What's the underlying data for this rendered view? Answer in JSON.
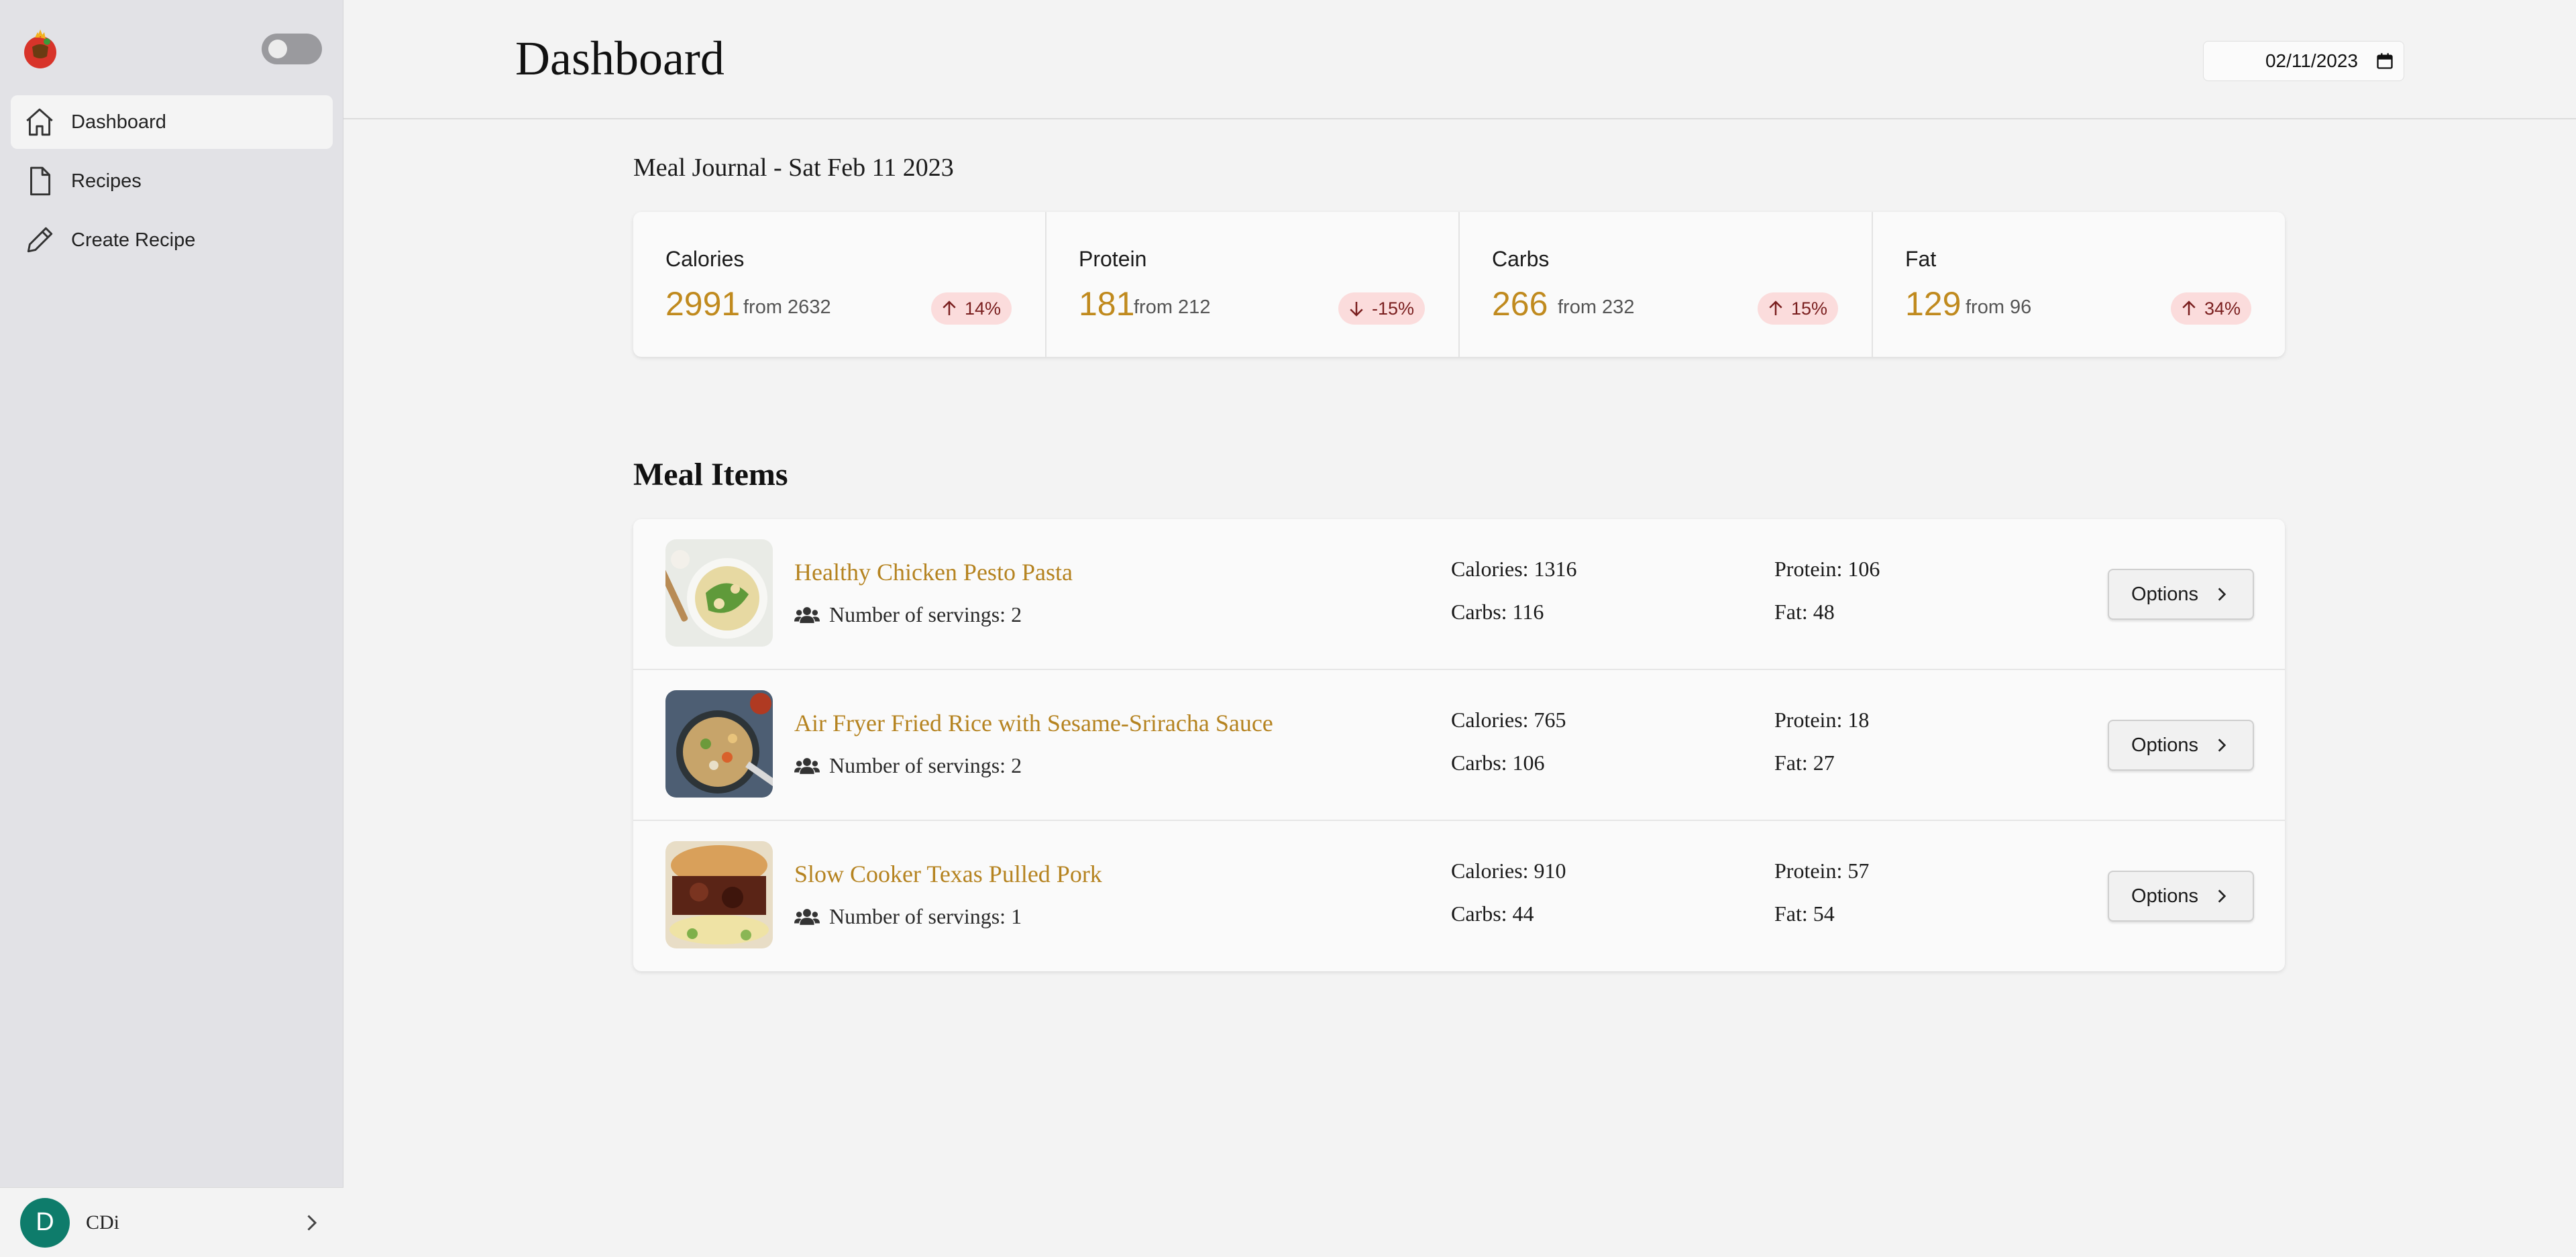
{
  "app": {
    "theme_toggle": "off"
  },
  "sidebar": {
    "items": [
      {
        "label": "Dashboard",
        "icon": "home-icon",
        "active": true
      },
      {
        "label": "Recipes",
        "icon": "document-icon",
        "active": false
      },
      {
        "label": "Create Recipe",
        "icon": "pencil-icon",
        "active": false
      }
    ]
  },
  "user": {
    "initial": "D",
    "name": "CDi",
    "avatar_color": "#0e7c6b"
  },
  "header": {
    "title": "Dashboard",
    "date": "02/11/2023"
  },
  "journal": {
    "title": "Meal Journal - Sat Feb 11 2023",
    "stats": [
      {
        "label": "Calories",
        "value": "2991",
        "from": "from 2632",
        "change": "14%",
        "direction": "up"
      },
      {
        "label": "Protein",
        "value": "181",
        "from": "from 212",
        "change": "-15%",
        "direction": "down"
      },
      {
        "label": "Carbs",
        "value": "266",
        "from": "from 232",
        "change": "15%",
        "direction": "up"
      },
      {
        "label": "Fat",
        "value": "129",
        "from": "from 96",
        "change": "34%",
        "direction": "up"
      }
    ]
  },
  "meals": {
    "title": "Meal Items",
    "options_label": "Options",
    "items": [
      {
        "name": "Healthy Chicken Pesto Pasta",
        "servings": "Number of servings: 2",
        "calories": "Calories: 1316",
        "carbs": "Carbs: 116",
        "protein": "Protein: 106",
        "fat": "Fat: 48"
      },
      {
        "name": "Air Fryer Fried Rice with Sesame-Sriracha Sauce",
        "servings": "Number of servings: 2",
        "calories": "Calories: 765",
        "carbs": "Carbs: 106",
        "protein": "Protein: 18",
        "fat": "Fat: 27"
      },
      {
        "name": "Slow Cooker Texas Pulled Pork",
        "servings": "Number of servings: 1",
        "calories": "Calories: 910",
        "carbs": "Carbs: 44",
        "protein": "Protein: 57",
        "fat": "Fat: 54"
      }
    ]
  },
  "colors": {
    "accent": "#c08a1e",
    "badge_bg": "#fbdcdc",
    "sidebar_bg": "#e2e2e6"
  }
}
